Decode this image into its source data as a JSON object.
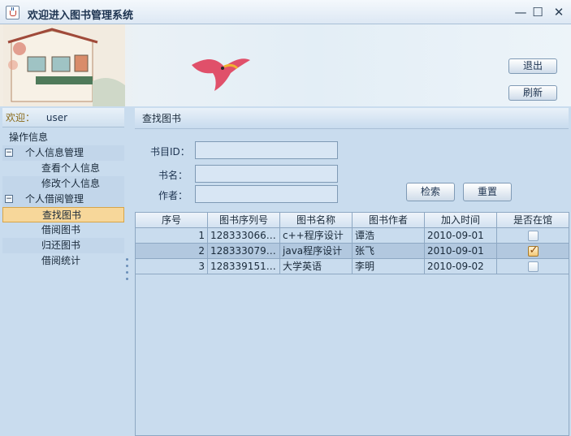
{
  "window": {
    "title": "欢迎进入图书管理系统",
    "controls": {
      "minimize": "—",
      "maximize": "☐",
      "close": "✕"
    }
  },
  "banner": {
    "logout_label": "退出",
    "refresh_label": "刷新"
  },
  "welcome": {
    "label": "欢迎：",
    "user": "user"
  },
  "nav": {
    "root": "操作信息",
    "groups": [
      {
        "toggle": "−",
        "label": "个人信息管理",
        "items": [
          "查看个人信息",
          "修改个人信息"
        ]
      },
      {
        "toggle": "−",
        "label": "个人借阅管理",
        "items": [
          "查找图书",
          "借阅图书",
          "归还图书",
          "借阅统计"
        ]
      }
    ],
    "selected_item": "查找图书"
  },
  "panel": {
    "title": "查找图书"
  },
  "search_form": {
    "id_label": "书目ID：",
    "id_value": "",
    "name_label": "书名：",
    "name_value": "",
    "author_label": "作者：",
    "author_value": "",
    "search_label": "检索",
    "reset_label": "重置"
  },
  "table": {
    "columns": [
      "序号",
      "图书序列号",
      "图书名称",
      "图书作者",
      "加入时间",
      "是否在馆"
    ],
    "rows": [
      {
        "no": "1",
        "serial": "1283330669...",
        "name": "c++程序设计",
        "author": "谭浩",
        "date": "2010-09-01",
        "in_library": false
      },
      {
        "no": "2",
        "serial": "1283330793...",
        "name": "java程序设计",
        "author": "张飞",
        "date": "2010-09-01",
        "in_library": true
      },
      {
        "no": "3",
        "serial": "1283391519...",
        "name": "大学英语",
        "author": "李明",
        "date": "2010-09-02",
        "in_library": false
      }
    ],
    "selected_row": 2
  },
  "colors": {
    "background": "#c9dcee",
    "selected_nav": "#f7d79a",
    "checkbox_checked": "#f4c876"
  }
}
